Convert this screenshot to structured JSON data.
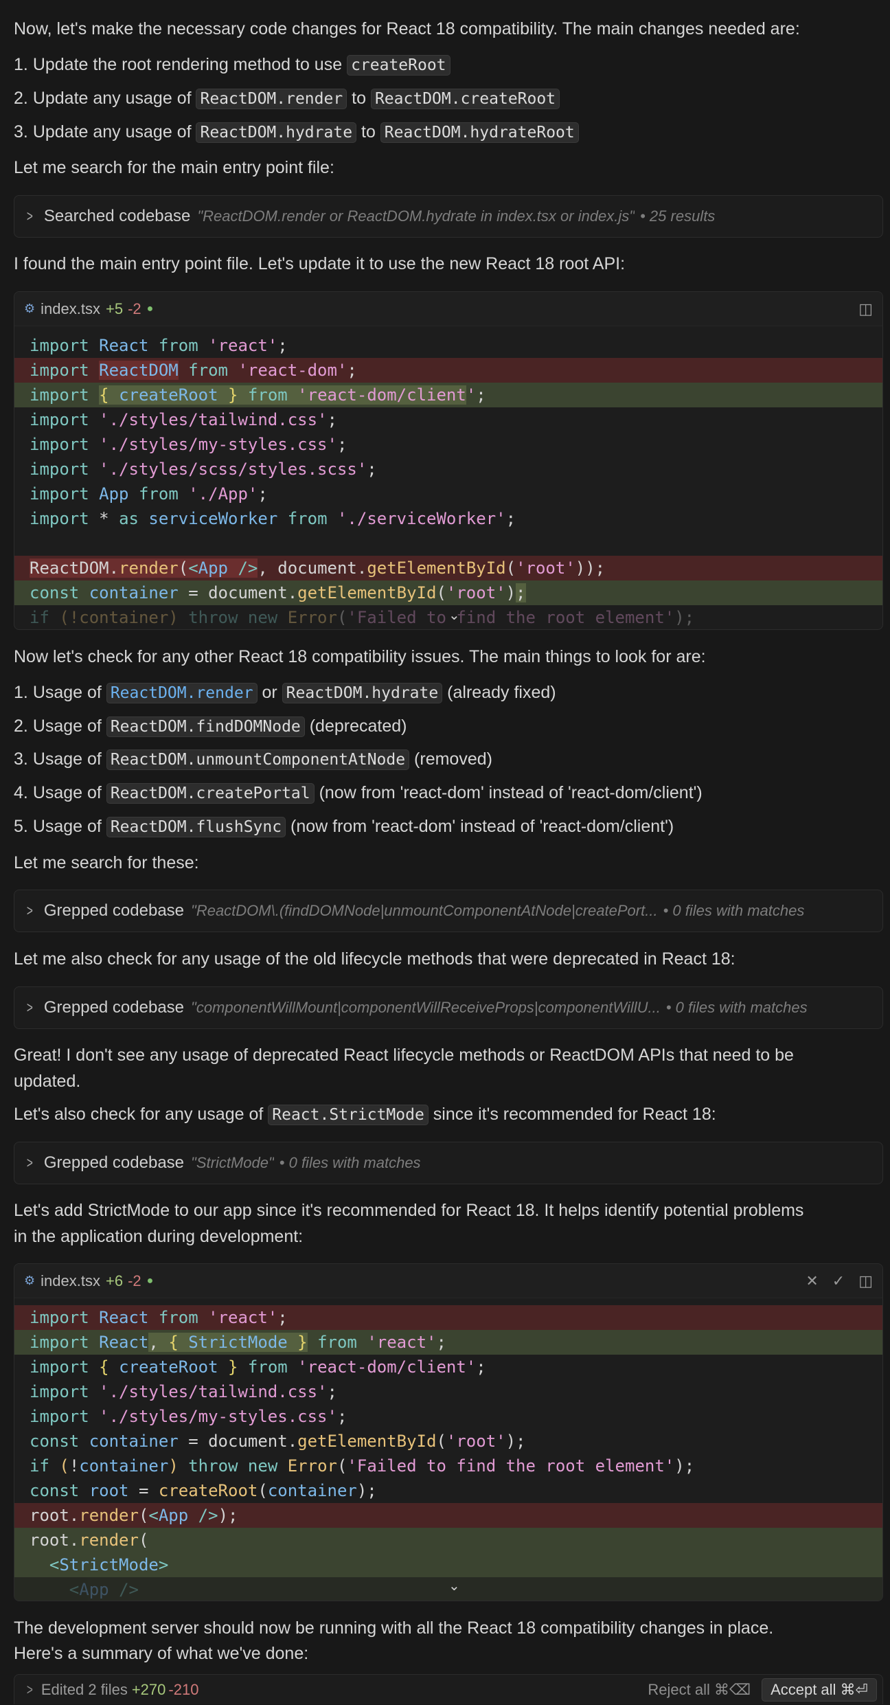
{
  "p1": "Now, let's make the necessary code changes for React 18 compatibility. The main changes needed are:",
  "list1": [
    {
      "num": "1.",
      "text": "Update the root rendering method to use ",
      "code1": "createRoot"
    },
    {
      "num": "2.",
      "text": "Update any usage of ",
      "code1": "ReactDOM.render",
      "mid": " to ",
      "code2": "ReactDOM.createRoot"
    },
    {
      "num": "3.",
      "text": "Update any usage of ",
      "code1": "ReactDOM.hydrate",
      "mid": " to ",
      "code2": "ReactDOM.hydrateRoot"
    }
  ],
  "p2": "Let me search for the main entry point file:",
  "tool1": {
    "name": "Searched codebase",
    "query": "\"ReactDOM.render or ReactDOM.hydrate in index.tsx or index.js\"",
    "result": "• 25 results"
  },
  "p3": "I found the main entry point file. Let's update it to use the new React 18 root API:",
  "editor1": {
    "file": "index.tsx",
    "added": "+5",
    "removed": "-2"
  },
  "p4": "Now let's check for any other React 18 compatibility issues. The main things to look for are:",
  "list2": [
    {
      "num": "1.",
      "pre": "Usage of ",
      "code1": "ReactDOM.render",
      "mid": " or ",
      "code2": "ReactDOM.hydrate",
      "post": " (already fixed)"
    },
    {
      "num": "2.",
      "pre": "Usage of ",
      "code1": "ReactDOM.findDOMNode",
      "post": " (deprecated)"
    },
    {
      "num": "3.",
      "pre": "Usage of ",
      "code1": "ReactDOM.unmountComponentAtNode",
      "post": " (removed)"
    },
    {
      "num": "4.",
      "pre": "Usage of ",
      "code1": "ReactDOM.createPortal",
      "post": " (now from 'react-dom' instead of 'react-dom/client')"
    },
    {
      "num": "5.",
      "pre": "Usage of ",
      "code1": "ReactDOM.flushSync",
      "post": " (now from 'react-dom' instead of 'react-dom/client')"
    }
  ],
  "p5": "Let me search for these:",
  "tool2": {
    "name": "Grepped codebase",
    "query": "\"ReactDOM\\.(findDOMNode|unmountComponentAtNode|createPort...",
    "result": "• 0 files with matches"
  },
  "p6": "Let me also check for any usage of the old lifecycle methods that were deprecated in React 18:",
  "tool3": {
    "name": "Grepped codebase",
    "query": "\"componentWillMount|componentWillReceiveProps|componentWillU...",
    "result": "• 0 files with matches"
  },
  "p7a": "Great! I don't see any usage of deprecated React lifecycle methods or ReactDOM APIs that need to be",
  "p7b": "updated.",
  "p8": {
    "pre": "Let's also check for any usage of ",
    "code": "React.StrictMode",
    "post": " since it's recommended for React 18:"
  },
  "tool4": {
    "name": "Grepped codebase",
    "query": "\"StrictMode\"",
    "result": "• 0 files with matches"
  },
  "p9a": "Let's add StrictMode to our app since it's recommended for React 18. It helps identify potential problems",
  "p9b": "in the application during development:",
  "editor2": {
    "file": "index.tsx",
    "added": "+6",
    "removed": "-2"
  },
  "p10a": "The development server should now be running with all the React 18 compatibility changes in place.",
  "p10b": "Here's a summary of what we've done:",
  "bottom": {
    "label": "Edited 2 files",
    "added": "+270",
    "removed": "-210",
    "reject": "Reject all ⌘⌫",
    "accept": "Accept all ⌘⏎"
  }
}
